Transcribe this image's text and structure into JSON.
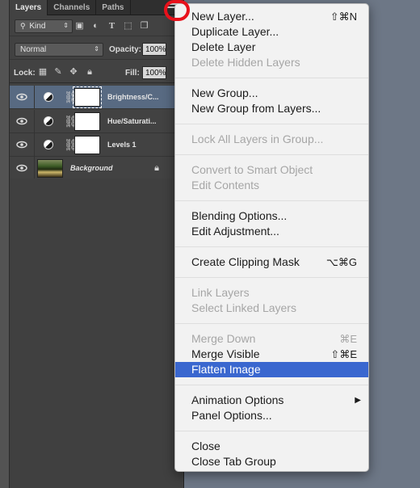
{
  "layers_panel": {
    "tabs": [
      "Layers",
      "Channels",
      "Paths"
    ],
    "filter_kind": "Kind",
    "blend_mode": "Normal",
    "opacity_label": "Opacity:",
    "opacity_value": "100%",
    "lock_label": "Lock:",
    "fill_label": "Fill:",
    "fill_value": "100%",
    "layers": [
      {
        "name": "Brightness/C...",
        "selected": true
      },
      {
        "name": "Hue/Saturati...",
        "selected": false
      },
      {
        "name": "Levels 1",
        "selected": false
      },
      {
        "name": "Background",
        "selected": false
      }
    ]
  },
  "context_menu": {
    "items": [
      {
        "label": "New Layer...",
        "shortcut": "⇧⌘N",
        "enabled": true
      },
      {
        "label": "Duplicate Layer...",
        "enabled": true
      },
      {
        "label": "Delete Layer",
        "enabled": true
      },
      {
        "label": "Delete Hidden Layers",
        "enabled": false
      },
      {
        "separator": true
      },
      {
        "label": "New Group...",
        "enabled": true
      },
      {
        "label": "New Group from Layers...",
        "enabled": true
      },
      {
        "separator": true
      },
      {
        "label": "Lock All Layers in Group...",
        "enabled": false
      },
      {
        "separator": true
      },
      {
        "label": "Convert to Smart Object",
        "enabled": false
      },
      {
        "label": "Edit Contents",
        "enabled": false
      },
      {
        "separator": true
      },
      {
        "label": "Blending Options...",
        "enabled": true
      },
      {
        "label": "Edit Adjustment...",
        "enabled": true
      },
      {
        "separator": true
      },
      {
        "label": "Create Clipping Mask",
        "shortcut": "⌥⌘G",
        "enabled": true
      },
      {
        "separator": true
      },
      {
        "label": "Link Layers",
        "enabled": false
      },
      {
        "label": "Select Linked Layers",
        "enabled": false
      },
      {
        "separator": true
      },
      {
        "label": "Merge Down",
        "shortcut": "⌘E",
        "enabled": false
      },
      {
        "label": "Merge Visible",
        "shortcut": "⇧⌘E",
        "enabled": true
      },
      {
        "label": "Flatten Image",
        "enabled": true,
        "highlighted": true
      },
      {
        "separator": true
      },
      {
        "label": "Animation Options",
        "enabled": true,
        "submenu": true
      },
      {
        "label": "Panel Options...",
        "enabled": true
      },
      {
        "separator": true
      },
      {
        "label": "Close",
        "enabled": true
      },
      {
        "label": "Close Tab Group",
        "enabled": true
      }
    ]
  },
  "colors": {
    "highlight": "#3a67cf",
    "annotation_circle": "#e8111b",
    "selected_layer": "#586a82"
  }
}
